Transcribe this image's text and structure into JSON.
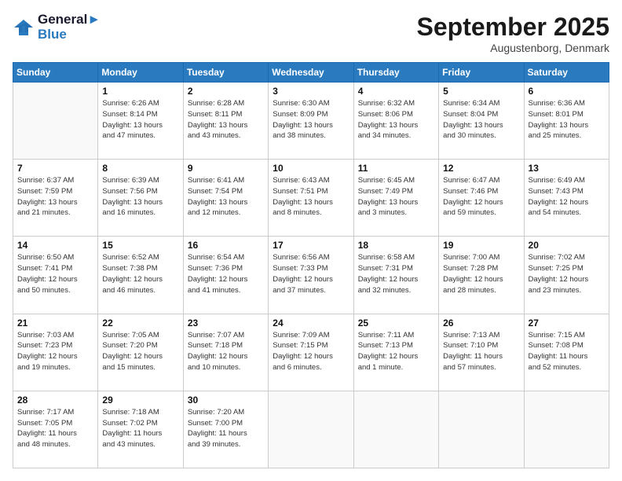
{
  "header": {
    "logo_line1": "General",
    "logo_line2": "Blue",
    "month_title": "September 2025",
    "location": "Augustenborg, Denmark"
  },
  "weekdays": [
    "Sunday",
    "Monday",
    "Tuesday",
    "Wednesday",
    "Thursday",
    "Friday",
    "Saturday"
  ],
  "weeks": [
    [
      {
        "day": "",
        "info": ""
      },
      {
        "day": "1",
        "info": "Sunrise: 6:26 AM\nSunset: 8:14 PM\nDaylight: 13 hours\nand 47 minutes."
      },
      {
        "day": "2",
        "info": "Sunrise: 6:28 AM\nSunset: 8:11 PM\nDaylight: 13 hours\nand 43 minutes."
      },
      {
        "day": "3",
        "info": "Sunrise: 6:30 AM\nSunset: 8:09 PM\nDaylight: 13 hours\nand 38 minutes."
      },
      {
        "day": "4",
        "info": "Sunrise: 6:32 AM\nSunset: 8:06 PM\nDaylight: 13 hours\nand 34 minutes."
      },
      {
        "day": "5",
        "info": "Sunrise: 6:34 AM\nSunset: 8:04 PM\nDaylight: 13 hours\nand 30 minutes."
      },
      {
        "day": "6",
        "info": "Sunrise: 6:36 AM\nSunset: 8:01 PM\nDaylight: 13 hours\nand 25 minutes."
      }
    ],
    [
      {
        "day": "7",
        "info": "Sunrise: 6:37 AM\nSunset: 7:59 PM\nDaylight: 13 hours\nand 21 minutes."
      },
      {
        "day": "8",
        "info": "Sunrise: 6:39 AM\nSunset: 7:56 PM\nDaylight: 13 hours\nand 16 minutes."
      },
      {
        "day": "9",
        "info": "Sunrise: 6:41 AM\nSunset: 7:54 PM\nDaylight: 13 hours\nand 12 minutes."
      },
      {
        "day": "10",
        "info": "Sunrise: 6:43 AM\nSunset: 7:51 PM\nDaylight: 13 hours\nand 8 minutes."
      },
      {
        "day": "11",
        "info": "Sunrise: 6:45 AM\nSunset: 7:49 PM\nDaylight: 13 hours\nand 3 minutes."
      },
      {
        "day": "12",
        "info": "Sunrise: 6:47 AM\nSunset: 7:46 PM\nDaylight: 12 hours\nand 59 minutes."
      },
      {
        "day": "13",
        "info": "Sunrise: 6:49 AM\nSunset: 7:43 PM\nDaylight: 12 hours\nand 54 minutes."
      }
    ],
    [
      {
        "day": "14",
        "info": "Sunrise: 6:50 AM\nSunset: 7:41 PM\nDaylight: 12 hours\nand 50 minutes."
      },
      {
        "day": "15",
        "info": "Sunrise: 6:52 AM\nSunset: 7:38 PM\nDaylight: 12 hours\nand 46 minutes."
      },
      {
        "day": "16",
        "info": "Sunrise: 6:54 AM\nSunset: 7:36 PM\nDaylight: 12 hours\nand 41 minutes."
      },
      {
        "day": "17",
        "info": "Sunrise: 6:56 AM\nSunset: 7:33 PM\nDaylight: 12 hours\nand 37 minutes."
      },
      {
        "day": "18",
        "info": "Sunrise: 6:58 AM\nSunset: 7:31 PM\nDaylight: 12 hours\nand 32 minutes."
      },
      {
        "day": "19",
        "info": "Sunrise: 7:00 AM\nSunset: 7:28 PM\nDaylight: 12 hours\nand 28 minutes."
      },
      {
        "day": "20",
        "info": "Sunrise: 7:02 AM\nSunset: 7:25 PM\nDaylight: 12 hours\nand 23 minutes."
      }
    ],
    [
      {
        "day": "21",
        "info": "Sunrise: 7:03 AM\nSunset: 7:23 PM\nDaylight: 12 hours\nand 19 minutes."
      },
      {
        "day": "22",
        "info": "Sunrise: 7:05 AM\nSunset: 7:20 PM\nDaylight: 12 hours\nand 15 minutes."
      },
      {
        "day": "23",
        "info": "Sunrise: 7:07 AM\nSunset: 7:18 PM\nDaylight: 12 hours\nand 10 minutes."
      },
      {
        "day": "24",
        "info": "Sunrise: 7:09 AM\nSunset: 7:15 PM\nDaylight: 12 hours\nand 6 minutes."
      },
      {
        "day": "25",
        "info": "Sunrise: 7:11 AM\nSunset: 7:13 PM\nDaylight: 12 hours\nand 1 minute."
      },
      {
        "day": "26",
        "info": "Sunrise: 7:13 AM\nSunset: 7:10 PM\nDaylight: 11 hours\nand 57 minutes."
      },
      {
        "day": "27",
        "info": "Sunrise: 7:15 AM\nSunset: 7:08 PM\nDaylight: 11 hours\nand 52 minutes."
      }
    ],
    [
      {
        "day": "28",
        "info": "Sunrise: 7:17 AM\nSunset: 7:05 PM\nDaylight: 11 hours\nand 48 minutes."
      },
      {
        "day": "29",
        "info": "Sunrise: 7:18 AM\nSunset: 7:02 PM\nDaylight: 11 hours\nand 43 minutes."
      },
      {
        "day": "30",
        "info": "Sunrise: 7:20 AM\nSunset: 7:00 PM\nDaylight: 11 hours\nand 39 minutes."
      },
      {
        "day": "",
        "info": ""
      },
      {
        "day": "",
        "info": ""
      },
      {
        "day": "",
        "info": ""
      },
      {
        "day": "",
        "info": ""
      }
    ]
  ]
}
